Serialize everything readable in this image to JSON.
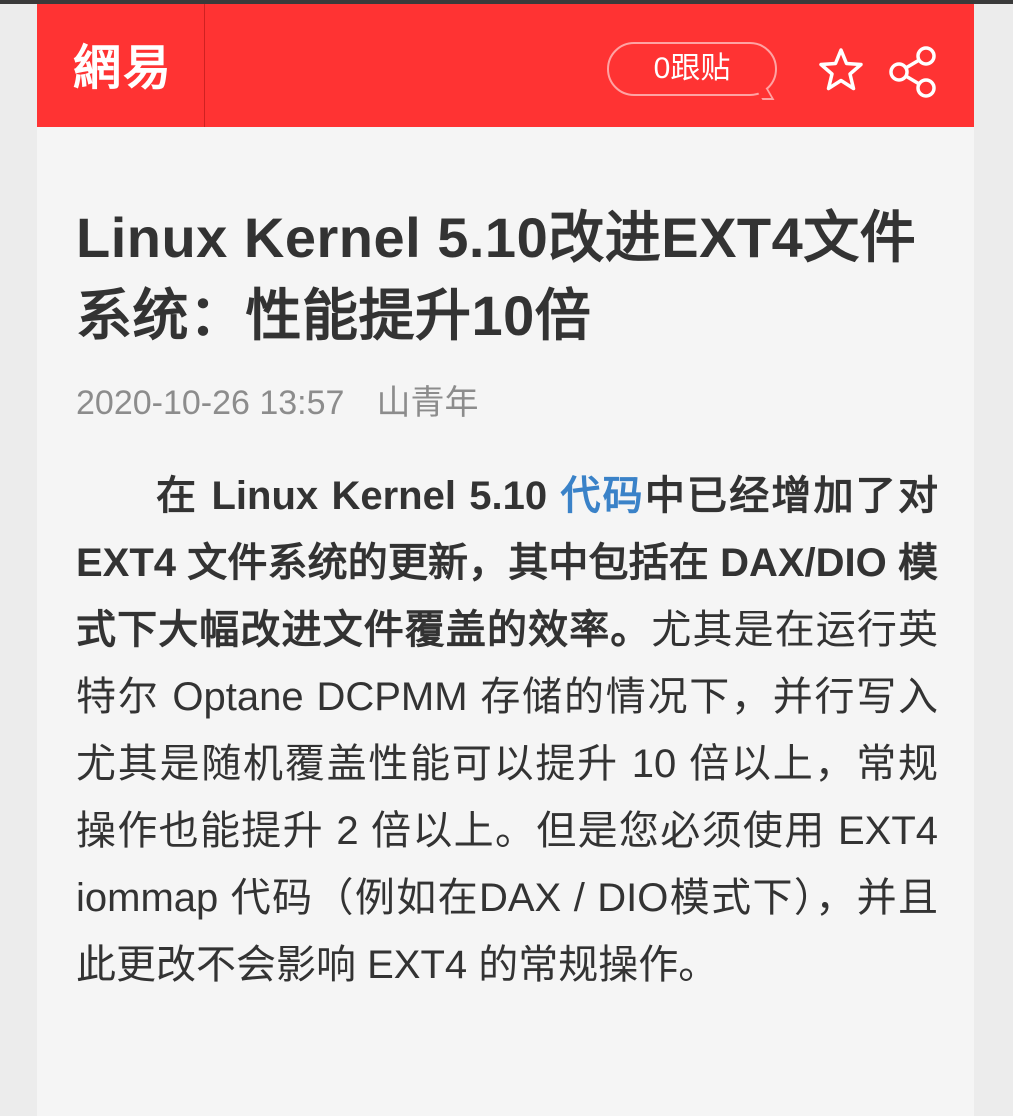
{
  "header": {
    "logo_text": "網易",
    "comment_button_label": "0跟贴",
    "star_icon": "star-icon",
    "share_icon": "share-icon"
  },
  "article": {
    "title": "Linux Kernel 5.10改进EXT4文件系统：性能提升10倍",
    "date": "2020-10-26 13:57",
    "author": "山青年",
    "body": {
      "bold_lead": "在 Linux Kernel 5.10 ",
      "link_text": "代码",
      "bold_rest": "中已经增加了对 EXT4 文件系统的更新，其中包括在 DAX/DIO 模式下大幅改进文件覆盖的效率。",
      "plain_text": "尤其是在运行英特尔 Optane DCPMM 存储的情况下，并行写入尤其是随机覆盖性能可以提升 10 倍以上，常规操作也能提升 2 倍以上。但是您必须使用 EXT4 iommap 代码（例如在DAX / DIO模式下），并且此更改不会影响 EXT4 的常规操作。"
    }
  },
  "colors": {
    "header_bg": "#ff3333",
    "link": "#3a82c8",
    "text": "#333333",
    "meta": "#8c8c8c"
  }
}
